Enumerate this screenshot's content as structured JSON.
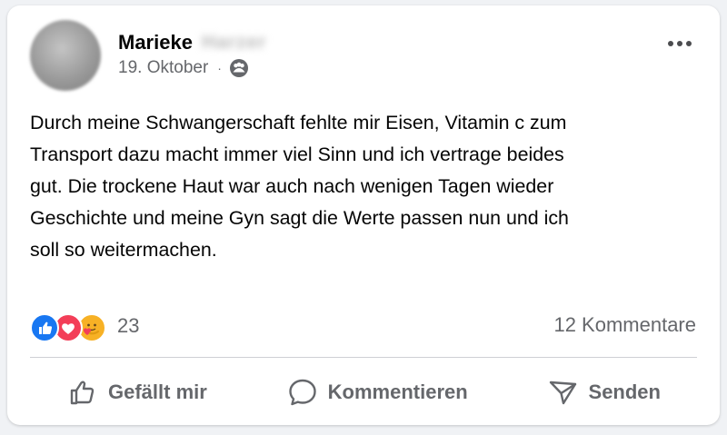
{
  "post": {
    "author_name": "Marieke",
    "author_surname_blurred": "Harzer",
    "date": "19. Oktober",
    "separator": "·",
    "audience_icon": "friends-icon",
    "text": "Durch meine Schwangerschaft fehlte mir Eisen, Vitamin c zum\nTransport dazu macht immer viel Sinn und ich vertrage beides\ngut. Die trockene Haut war auch nach wenigen Tagen wieder\nGeschichte und meine Gyn sagt die Werte passen nun und ich\nsoll so weitermachen."
  },
  "reactions": {
    "icons": [
      "like-icon",
      "love-icon",
      "care-icon"
    ],
    "count": "23"
  },
  "comments": {
    "count_label": "12 Kommentare"
  },
  "actions": {
    "like_label": "Gefällt mir",
    "comment_label": "Kommentieren",
    "share_label": "Senden"
  },
  "colors": {
    "like_blue": "#1877f2",
    "love_red": "#f33e58",
    "care_yellow": "#f7b125",
    "secondary_text": "#65676b"
  }
}
